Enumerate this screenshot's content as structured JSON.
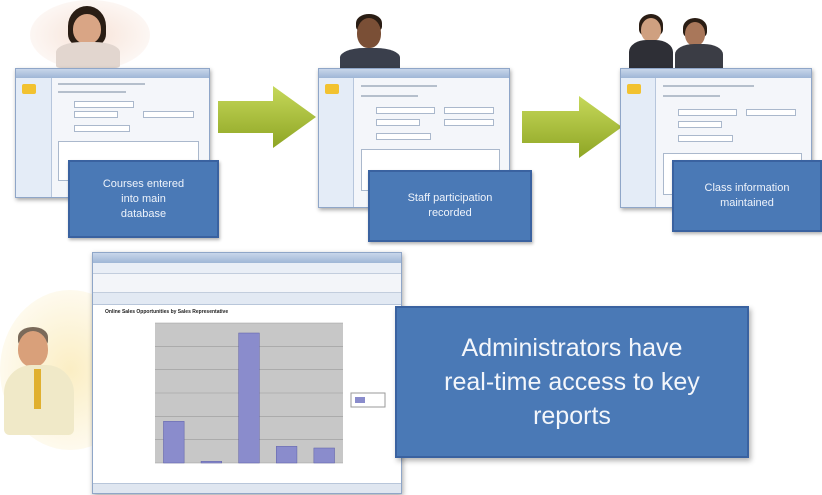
{
  "steps": [
    {
      "caption": "Courses entered\ninto main\ndatabase"
    },
    {
      "caption": "Staff participation\nrecorded"
    },
    {
      "caption": "Class information\nmaintained"
    }
  ],
  "headline": "Administrators have\nreal-time access to key\nreports",
  "report": {
    "title": "Online Sales Opportunities by Sales Representative"
  },
  "colors": {
    "caption_blue": "#4a79b6",
    "arrow_green": "#9ab52a",
    "bar_color": "#8a8ccc",
    "plot_bg": "#c7c7c7"
  },
  "chart_data": {
    "type": "bar",
    "title": "",
    "xlabel": "",
    "ylabel": "",
    "categories": [
      "",
      "",
      "",
      "",
      ""
    ],
    "values": [
      1250,
      50,
      3900,
      500,
      450
    ],
    "ylim": [
      0,
      4200
    ],
    "legend": "right"
  }
}
